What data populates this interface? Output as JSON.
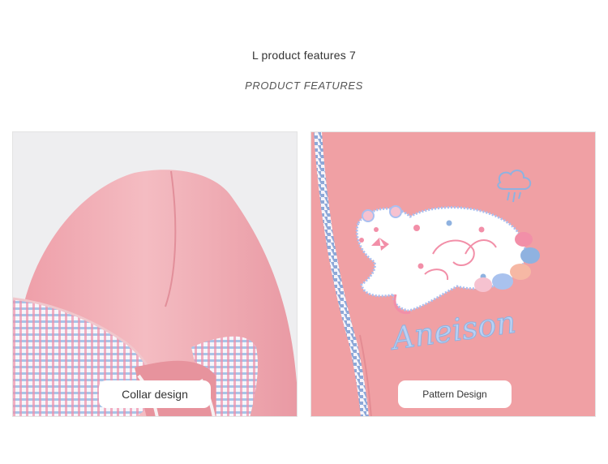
{
  "header": {
    "title": "L product features 7",
    "subtitle": "PRODUCT FEATURES"
  },
  "panels": [
    {
      "caption": "Collar design",
      "photo": "pink-hood-with-gingham-lining"
    },
    {
      "caption": "Pattern Design",
      "photo": "embroidered-bear-patch"
    }
  ],
  "embroidery": {
    "text": "Aneison"
  },
  "colors": {
    "garment_pink": "#f0a0a4",
    "hood_pink": "#f2b3b9",
    "gingham_blue": "#8fb2e0",
    "gingham_pink": "#f28fa8"
  }
}
